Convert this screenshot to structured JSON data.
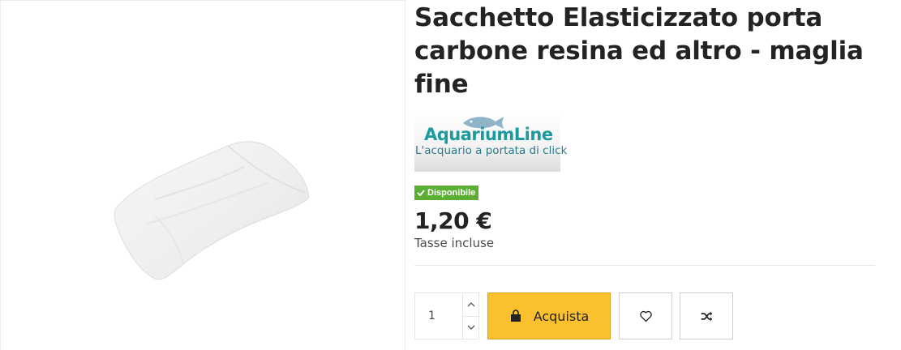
{
  "product": {
    "title": "Sacchetto Elasticizzato porta carbone resina ed altro - maglia fine",
    "image_icon": "white-mesh-bag",
    "availability": "Disponibile",
    "price": "1,20 €",
    "tax_note": "Tasse incluse"
  },
  "brand": {
    "name": "AquariumLine",
    "tagline": "L'acquario a portata di click"
  },
  "cart": {
    "quantity": "1",
    "buy_label": "Acquista"
  },
  "icons": {
    "qty_up": "chevron-up-icon",
    "qty_down": "chevron-down-icon",
    "buy": "shopping-bag-icon",
    "wishlist": "heart-icon",
    "compare": "shuffle-icon",
    "availability": "check-icon"
  },
  "colors": {
    "buy_button": "#fbc02d",
    "available_badge": "#5bae32",
    "brand_teal": "#1d9aa0"
  }
}
